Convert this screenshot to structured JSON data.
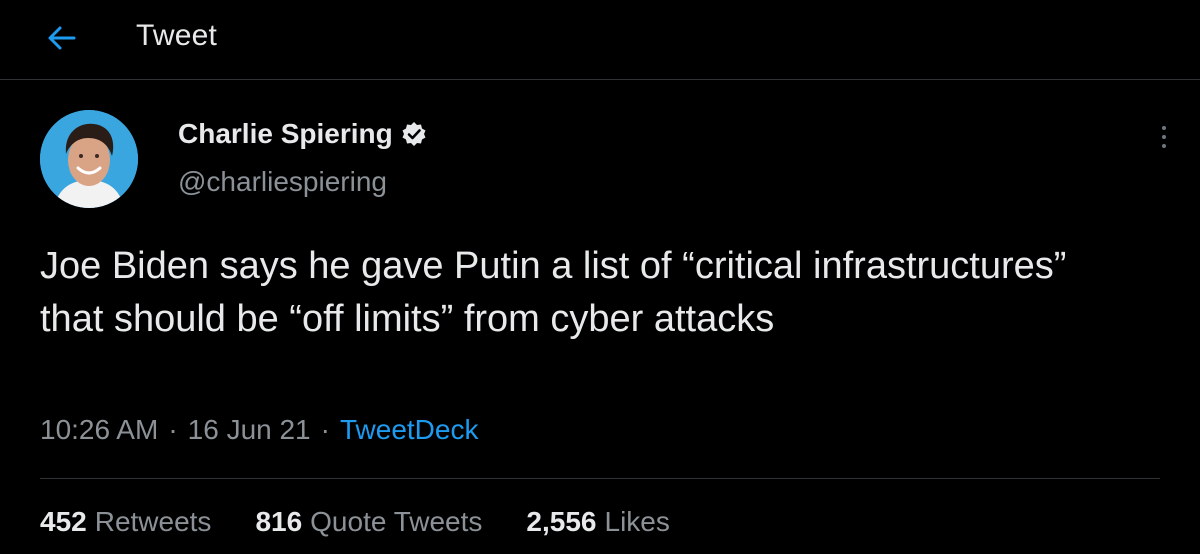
{
  "header": {
    "title": "Tweet",
    "back_icon": "arrow-left-icon",
    "accent": "#1d9bf0"
  },
  "author": {
    "display_name": "Charlie Spiering",
    "handle": "@charliespiering",
    "verified_icon": "verified-badge-icon"
  },
  "tweet": {
    "text": "Joe Biden says he gave Putin a list of “critical infrastructures” that should be “off limits” from cyber attacks",
    "time": "10:26 AM",
    "date": "16 Jun 21",
    "separator": "·",
    "source": "TweetDeck"
  },
  "stats": {
    "retweets_count": "452",
    "retweets_label": "Retweets",
    "quote_count": "816",
    "quote_label": "Quote Tweets",
    "likes_count": "2,556",
    "likes_label": "Likes"
  },
  "colors": {
    "background": "#000000",
    "primary_text": "#e7e9ea",
    "secondary_text": "#8b9196",
    "link": "#1d9bf0",
    "divider": "#2f3336"
  }
}
